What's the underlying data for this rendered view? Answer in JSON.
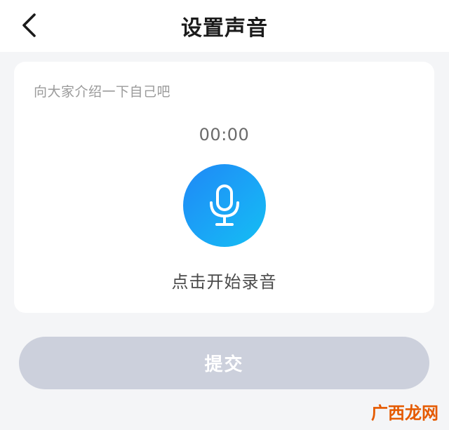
{
  "header": {
    "title": "设置声音",
    "back_icon": "chevron-left-icon"
  },
  "card": {
    "prompt": "向大家介绍一下自己吧",
    "timer": "00:00",
    "mic_icon": "microphone-icon",
    "record_label": "点击开始录音"
  },
  "submit": {
    "label": "提交"
  },
  "watermark": {
    "text": "广西龙网"
  },
  "colors": {
    "accent": "#1aa6f6",
    "submit_disabled": "#ccd0dc",
    "watermark": "#e55a00"
  }
}
